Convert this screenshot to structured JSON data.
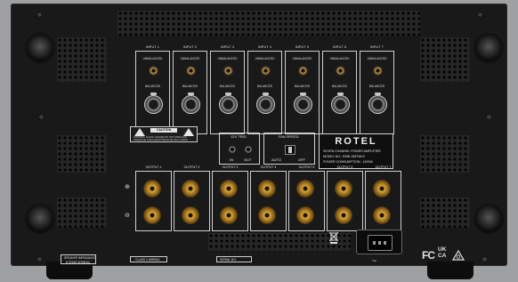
{
  "inputs": {
    "items": [
      {
        "label": "INPUT 1"
      },
      {
        "label": "INPUT 2"
      },
      {
        "label": "INPUT 3"
      },
      {
        "label": "INPUT 4"
      },
      {
        "label": "INPUT 5"
      },
      {
        "label": "INPUT 6"
      },
      {
        "label": "INPUT 7"
      }
    ],
    "unbalanced": "UNBALANCED",
    "balanced": "BALANCED"
  },
  "outputs": {
    "items": [
      {
        "label": "OUTPUT 1"
      },
      {
        "label": "OUTPUT 2"
      },
      {
        "label": "OUTPUT 3"
      },
      {
        "label": "OUTPUT 4"
      },
      {
        "label": "OUTPUT 5"
      },
      {
        "label": "OUTPUT 6"
      },
      {
        "label": "OUTPUT 7"
      }
    ]
  },
  "caution": {
    "title": "CAUTION",
    "text": "WARNING: SHOCK HAZARD DO NOT OPEN AVIS RISQUE DE CHOC ELECTRIQUE NE PAS OUVRIR"
  },
  "trig": {
    "title": "12V TRIG",
    "in": "IN",
    "out": "OUT"
  },
  "fan": {
    "title": "FAN SPEED",
    "auto": "AUTO",
    "off": "OFF"
  },
  "brand": {
    "logo": "ROTEL",
    "line1": "SEVEN CHANNEL POWER AMPLIFIER",
    "line2": "MODEL NO.: RMB-1587MKII",
    "line3": "POWER CONSUMPTION : 1400W"
  },
  "bottom": {
    "impedance1": "SPEAKER IMPEDANCE",
    "impedance2": "8 OHMS NOMINAL",
    "class2": "CLASS 2 WIRING",
    "serial": "SERIAL NO."
  },
  "cert": {
    "fc": "FC",
    "ukca_top": "UK",
    "ukca_bottom": "CA"
  },
  "icons": [
    "recycle-bin-icon",
    "ac-power-icon",
    "triangle-cert-icon"
  ]
}
